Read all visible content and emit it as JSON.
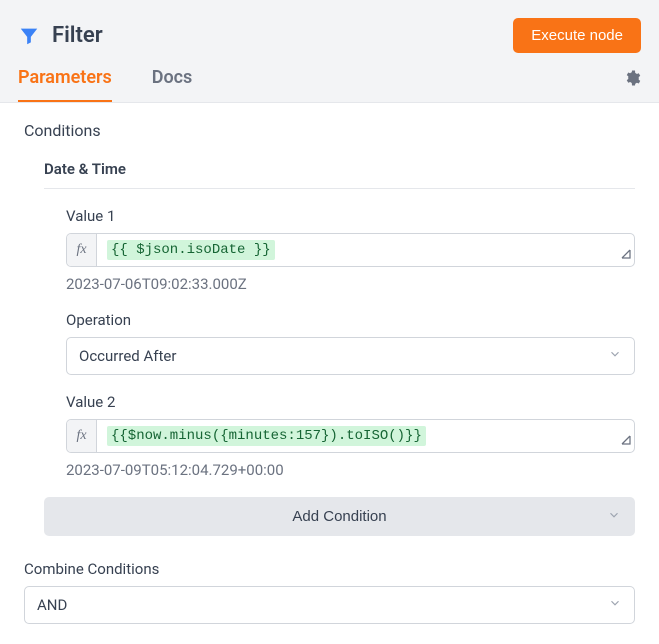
{
  "header": {
    "title": "Filter",
    "execute_label": "Execute node"
  },
  "tabs": {
    "parameters": "Parameters",
    "docs": "Docs"
  },
  "sections": {
    "conditions": "Conditions",
    "group": "Date & Time"
  },
  "value1": {
    "label": "Value 1",
    "expression": "{{ $json.isoDate }}",
    "resolved": "2023-07-06T09:02:33.000Z"
  },
  "operation": {
    "label": "Operation",
    "value": "Occurred After"
  },
  "value2": {
    "label": "Value 2",
    "expression": "{{$now.minus({minutes:157}).toISO()}}",
    "resolved": "2023-07-09T05:12:04.729+00:00"
  },
  "add_condition_label": "Add Condition",
  "combine": {
    "label": "Combine Conditions",
    "value": "AND"
  },
  "icons": {
    "fx": "fx"
  }
}
